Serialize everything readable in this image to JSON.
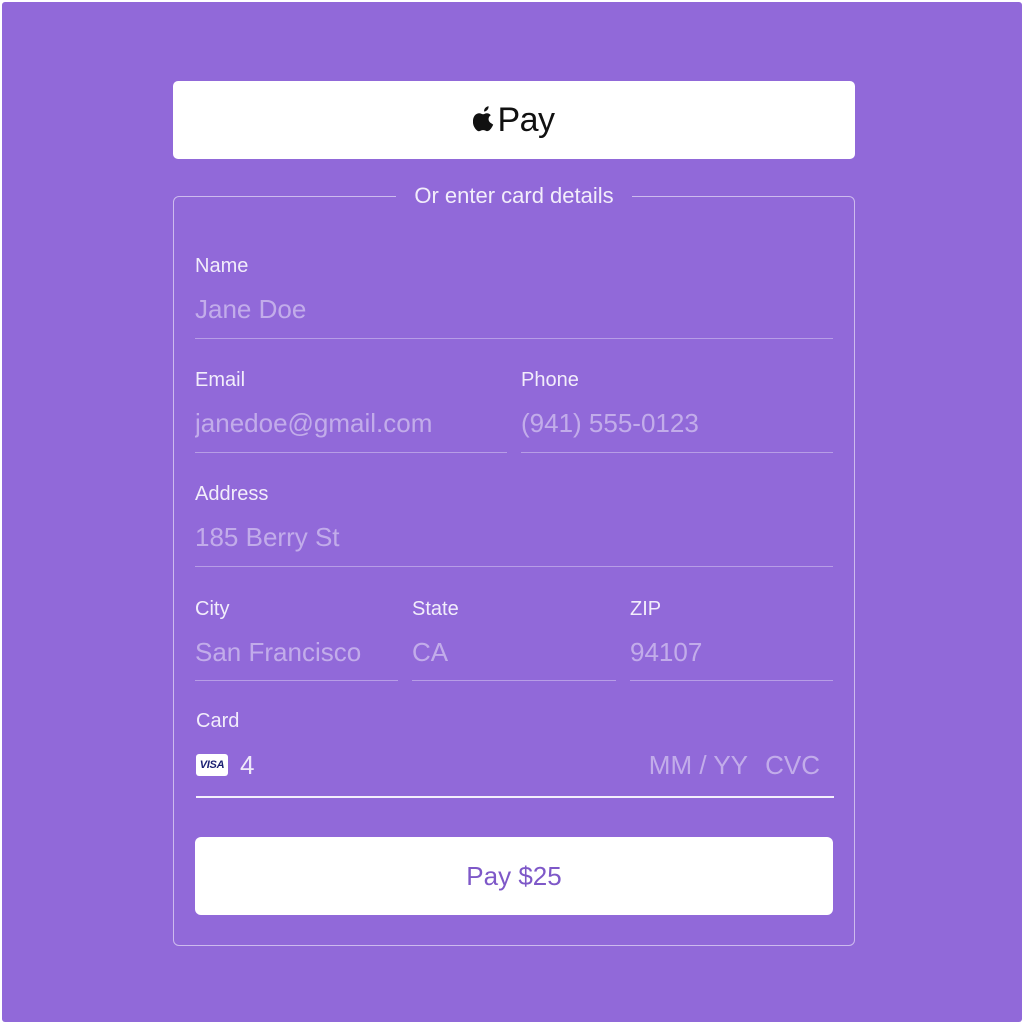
{
  "apple_pay": {
    "label": "Pay",
    "icon": "apple-icon"
  },
  "divider_text": "Or enter card details",
  "form": {
    "name": {
      "label": "Name",
      "placeholder": "Jane Doe"
    },
    "email": {
      "label": "Email",
      "placeholder": "janedoe@gmail.com"
    },
    "phone": {
      "label": "Phone",
      "placeholder": "(941) 555-0123"
    },
    "address": {
      "label": "Address",
      "placeholder": "185 Berry St"
    },
    "city": {
      "label": "City",
      "placeholder": "San Francisco"
    },
    "state": {
      "label": "State",
      "placeholder": "CA"
    },
    "zip": {
      "label": "ZIP",
      "placeholder": "94107"
    },
    "card": {
      "label": "Card",
      "brand": "VISA",
      "brand_icon": "visa-icon",
      "number_value": "4",
      "expiry_placeholder": "MM / YY",
      "cvc_placeholder": "CVC"
    }
  },
  "pay_button": {
    "label": "Pay $25"
  },
  "colors": {
    "background": "#9169d9",
    "button_bg": "#ffffff",
    "pay_button_text": "#7e58c8"
  }
}
